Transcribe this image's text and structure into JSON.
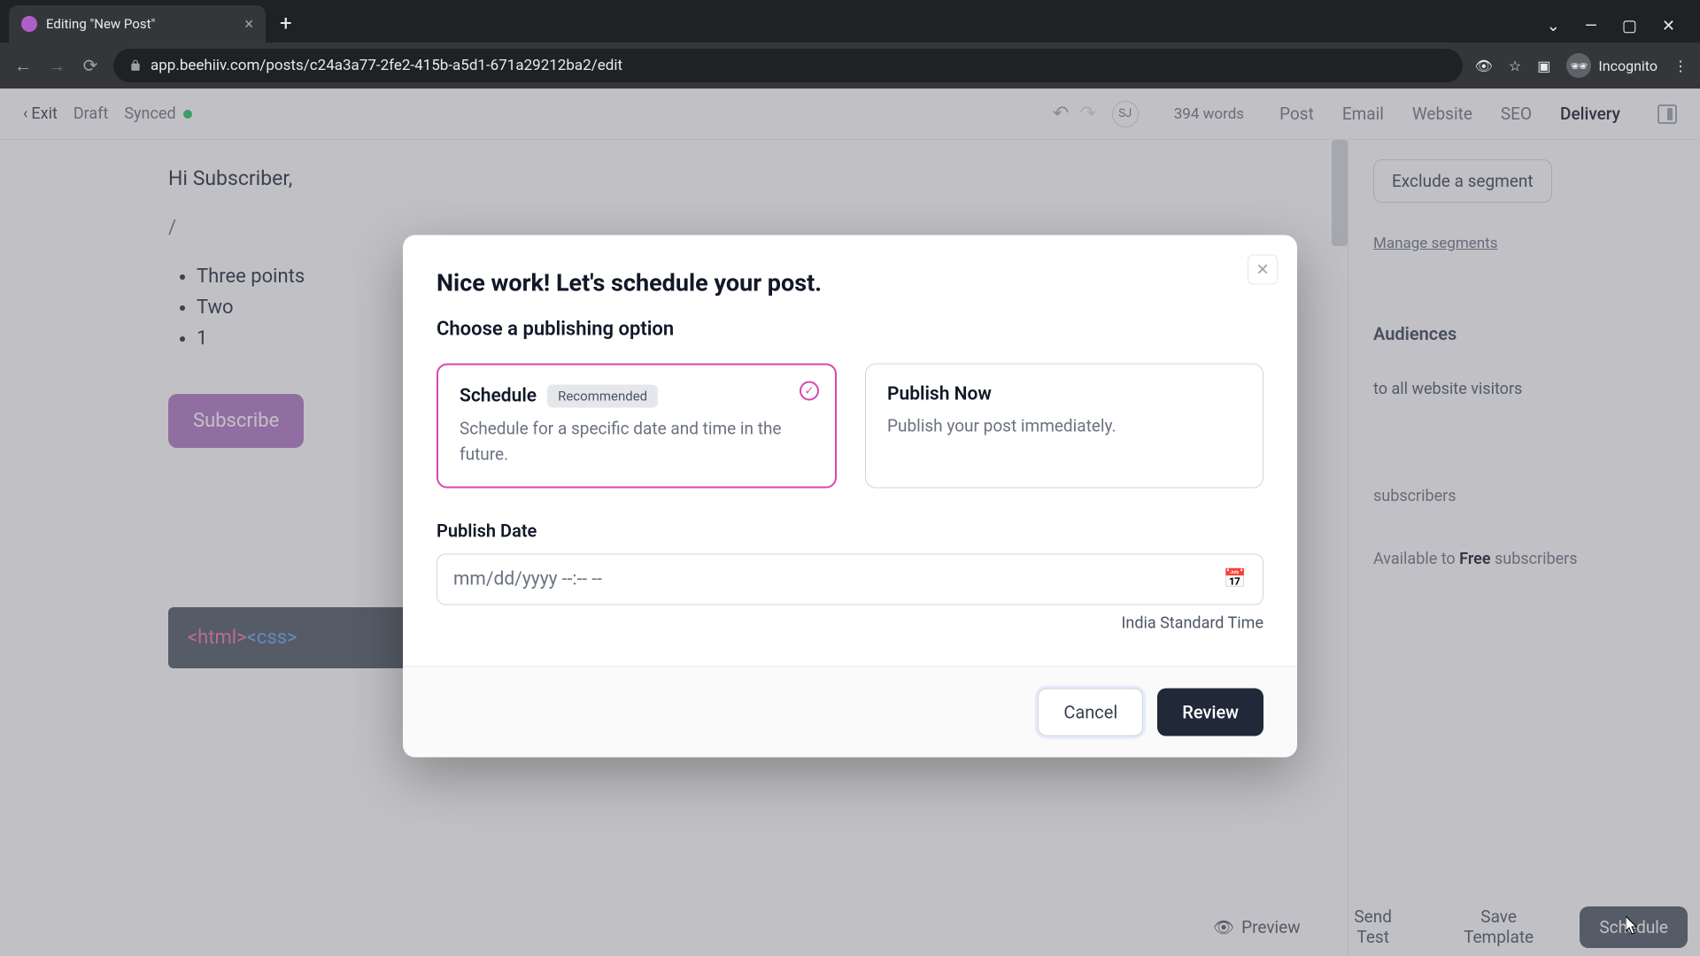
{
  "browser": {
    "tab_title": "Editing \"New Post\"",
    "url": "app.beehiiv.com/posts/c24a3a77-2fe2-415b-a5d1-671a29212ba2/edit",
    "incognito_label": "Incognito"
  },
  "app_bar": {
    "exit": "Exit",
    "draft": "Draft",
    "synced": "Synced",
    "user_initials": "SJ",
    "word_count": "394 words",
    "tabs": {
      "post": "Post",
      "email": "Email",
      "website": "Website",
      "seo": "SEO",
      "delivery": "Delivery"
    }
  },
  "editor": {
    "greeting": "Hi Subscriber,",
    "slash": "/",
    "bullets": [
      "Three points",
      "Two",
      "1"
    ],
    "subscribe": "Subscribe",
    "code": "<html><css>"
  },
  "side_panel": {
    "exclude": "Exclude a segment",
    "manage": "Manage segments",
    "audiences": "Audiences",
    "visible_to": "to all website visitors",
    "subscribers": "subscribers",
    "avail_prefix": "Available to ",
    "avail_bold": "Free",
    "avail_suffix": " subscribers"
  },
  "footer": {
    "preview": "Preview",
    "send_test": "Send Test",
    "save_template": "Save Template",
    "schedule": "Schedule"
  },
  "modal": {
    "title": "Nice work! Let's schedule your post.",
    "subtitle": "Choose a publishing option",
    "schedule": {
      "title": "Schedule",
      "badge": "Recommended",
      "desc": "Schedule for a specific date and time in the future."
    },
    "publish_now": {
      "title": "Publish Now",
      "desc": "Publish your post immediately."
    },
    "publish_date_label": "Publish Date",
    "date_placeholder": "mm/dd/yyyy --:-- --",
    "timezone": "India Standard Time",
    "cancel": "Cancel",
    "review": "Review"
  }
}
